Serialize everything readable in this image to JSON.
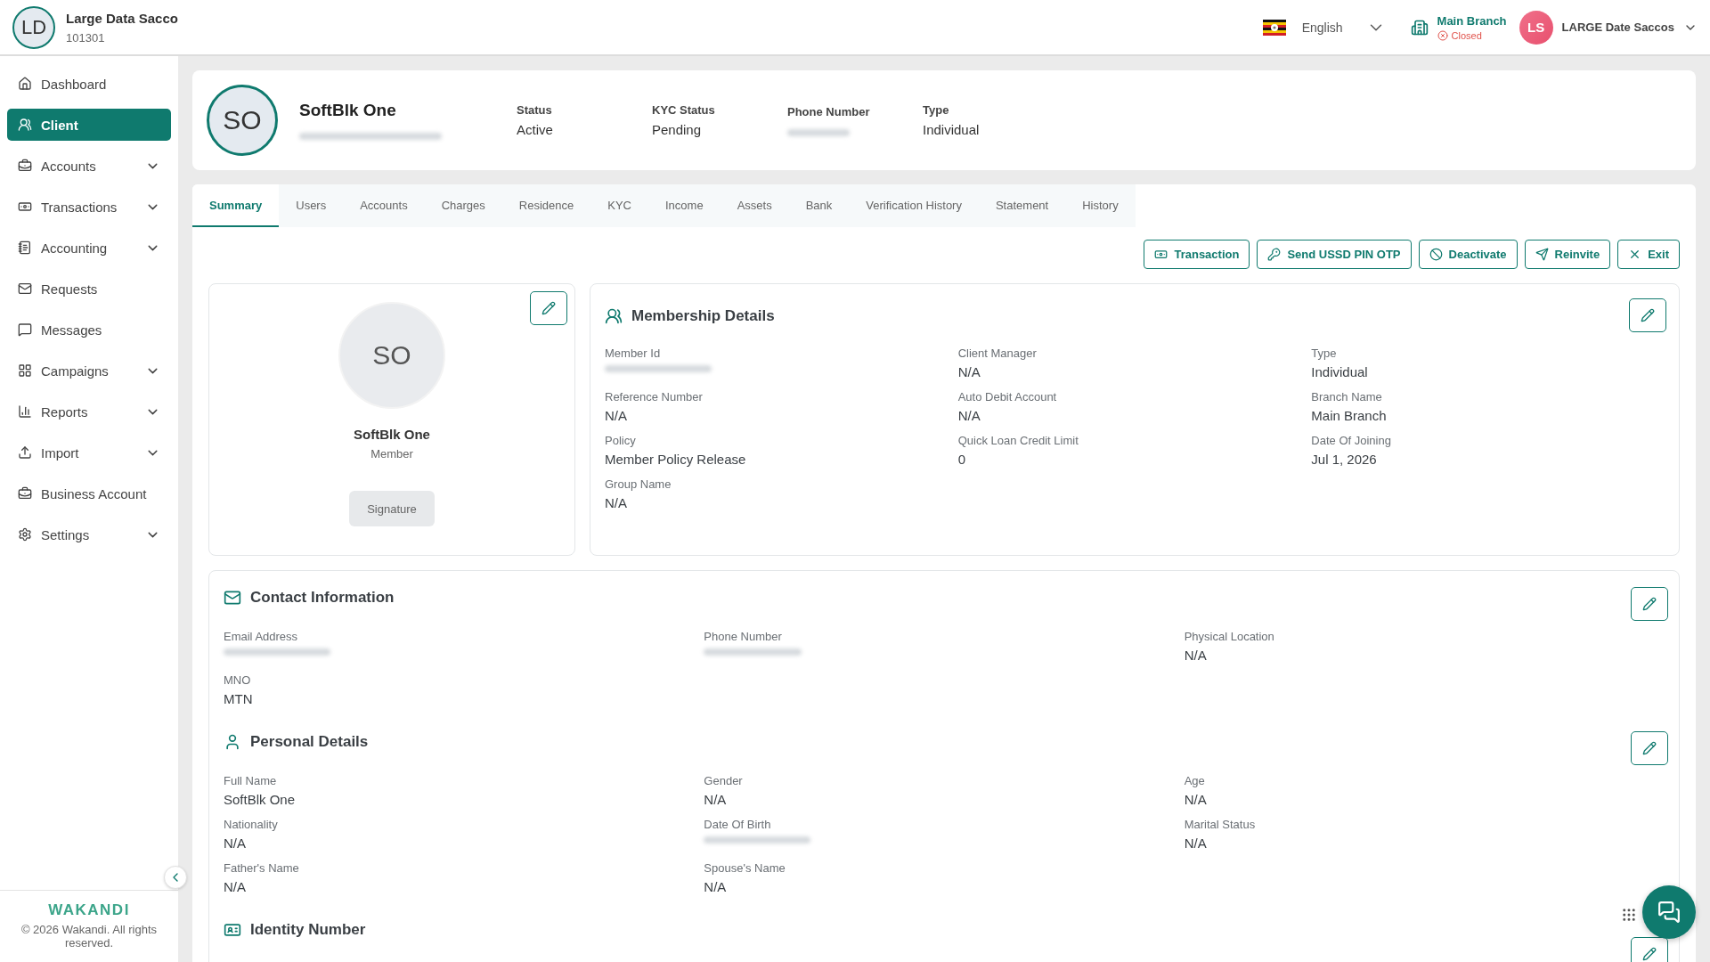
{
  "org": {
    "initials": "LD",
    "name": "Large Data Sacco",
    "code": "101301"
  },
  "topbar": {
    "language": "English",
    "branch": {
      "name": "Main Branch",
      "status": "Closed"
    },
    "user": {
      "initials": "LS",
      "name": "LARGE Date Saccos"
    }
  },
  "sidebar": {
    "items": [
      {
        "label": "Dashboard",
        "selected": false,
        "expandable": false
      },
      {
        "label": "Client",
        "selected": true,
        "expandable": false
      },
      {
        "label": "Accounts",
        "selected": false,
        "expandable": true
      },
      {
        "label": "Transactions",
        "selected": false,
        "expandable": true
      },
      {
        "label": "Accounting",
        "selected": false,
        "expandable": true
      },
      {
        "label": "Requests",
        "selected": false,
        "expandable": false
      },
      {
        "label": "Messages",
        "selected": false,
        "expandable": false
      },
      {
        "label": "Campaigns",
        "selected": false,
        "expandable": true
      },
      {
        "label": "Reports",
        "selected": false,
        "expandable": true
      },
      {
        "label": "Import",
        "selected": false,
        "expandable": true
      },
      {
        "label": "Business Account",
        "selected": false,
        "expandable": false
      },
      {
        "label": "Settings",
        "selected": false,
        "expandable": true
      }
    ],
    "footer": {
      "logo": "WAKANDI",
      "copyright": "© 2026 Wakandi. All rights reserved."
    }
  },
  "client": {
    "initials": "SO",
    "name": "SoftBlk One",
    "subtitle_redacted": true,
    "facts": [
      {
        "label": "Status",
        "value": "Active"
      },
      {
        "label": "KYC Status",
        "value": "Pending"
      },
      {
        "label": "Phone Number",
        "redacted": true
      },
      {
        "label": "Type",
        "value": "Individual"
      }
    ]
  },
  "tabs": [
    {
      "label": "Summary",
      "selected": true
    },
    {
      "label": "Users",
      "selected": false
    },
    {
      "label": "Accounts",
      "selected": false
    },
    {
      "label": "Charges",
      "selected": false
    },
    {
      "label": "Residence",
      "selected": false
    },
    {
      "label": "KYC",
      "selected": false
    },
    {
      "label": "Income",
      "selected": false
    },
    {
      "label": "Assets",
      "selected": false
    },
    {
      "label": "Bank",
      "selected": false
    },
    {
      "label": "Verification History",
      "selected": false
    },
    {
      "label": "Statement",
      "selected": false
    },
    {
      "label": "History",
      "selected": false
    }
  ],
  "actions": [
    "Transaction",
    "Send USSD PIN OTP",
    "Deactivate",
    "Reinvite",
    "Exit"
  ],
  "profile": {
    "initials": "SO",
    "name": "SoftBlk One",
    "role": "Member",
    "signature": "Signature"
  },
  "membership": {
    "title": "Membership Details",
    "fields": [
      {
        "label": "Member Id",
        "redacted": true
      },
      {
        "label": "Client Manager",
        "value": "N/A"
      },
      {
        "label": "Type",
        "value": "Individual"
      },
      {
        "label": "Reference Number",
        "value": "N/A"
      },
      {
        "label": "Auto Debit Account",
        "value": "N/A"
      },
      {
        "label": "Branch Name",
        "value": "Main Branch"
      },
      {
        "label": "Policy",
        "value": "Member Policy Release"
      },
      {
        "label": "Quick Loan Credit Limit",
        "value": "0"
      },
      {
        "label": "Date Of Joining",
        "value": "Jul 1, 2026"
      },
      {
        "label": "Group Name",
        "value": "N/A"
      }
    ]
  },
  "sections": [
    {
      "title": "Contact Information",
      "fields": [
        {
          "label": "Email Address",
          "redacted": true
        },
        {
          "label": "Phone Number",
          "redacted": true
        },
        {
          "label": "Physical Location",
          "value": "N/A"
        },
        {
          "label": "MNO",
          "value": "MTN"
        }
      ]
    },
    {
      "title": "Personal Details",
      "fields": [
        {
          "label": "Full Name",
          "value": "SoftBlk One"
        },
        {
          "label": "Gender",
          "value": "N/A"
        },
        {
          "label": "Age",
          "value": "N/A"
        },
        {
          "label": "Nationality",
          "value": "N/A"
        },
        {
          "label": "Date Of Birth",
          "redacted": true
        },
        {
          "label": "Marital Status",
          "value": "N/A"
        },
        {
          "label": "Father's Name",
          "value": "N/A"
        },
        {
          "label": "Spouse's Name",
          "value": "N/A"
        }
      ]
    },
    {
      "title": "Identity Number"
    }
  ]
}
